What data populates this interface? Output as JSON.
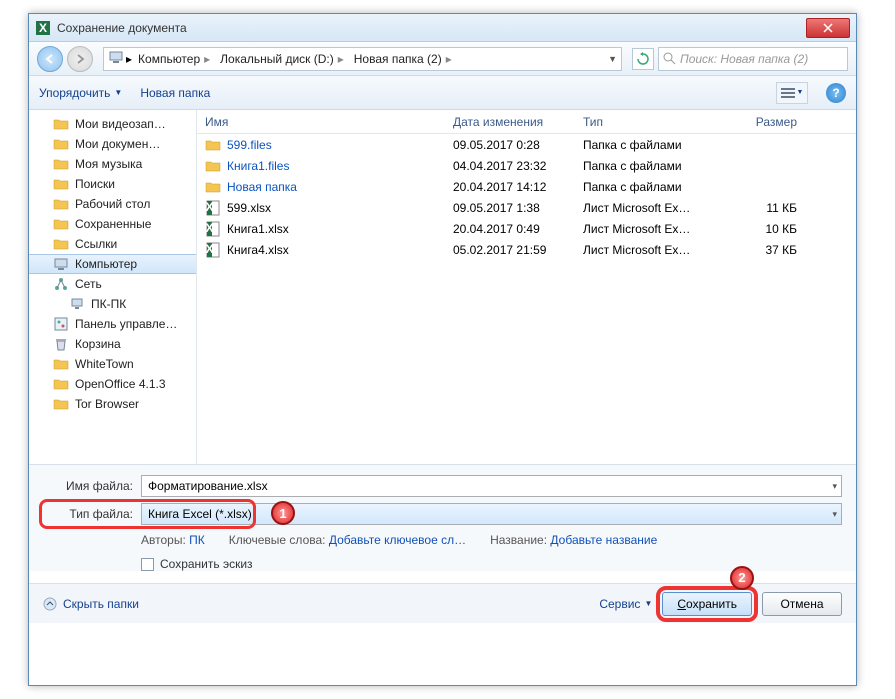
{
  "title": "Сохранение документа",
  "breadcrumbs": [
    "Компьютер",
    "Локальный диск (D:)",
    "Новая папка (2)"
  ],
  "search_placeholder": "Поиск: Новая папка (2)",
  "toolbar": {
    "organize": "Упорядочить",
    "newfolder": "Новая папка"
  },
  "tree": [
    {
      "label": "Мои видеозап…",
      "icon": "folder"
    },
    {
      "label": "Мои докумен…",
      "icon": "folder"
    },
    {
      "label": "Моя музыка",
      "icon": "folder"
    },
    {
      "label": "Поиски",
      "icon": "folder"
    },
    {
      "label": "Рабочий стол",
      "icon": "folder"
    },
    {
      "label": "Сохраненные",
      "icon": "folder"
    },
    {
      "label": "Ссылки",
      "icon": "folder"
    },
    {
      "label": "Компьютер",
      "icon": "computer",
      "selected": true
    },
    {
      "label": "Сеть",
      "icon": "network"
    },
    {
      "label": "ПК-ПК",
      "icon": "pc",
      "indent": true
    },
    {
      "label": "Панель управле…",
      "icon": "control"
    },
    {
      "label": "Корзина",
      "icon": "bin"
    },
    {
      "label": "WhiteTown",
      "icon": "folder"
    },
    {
      "label": "OpenOffice 4.1.3",
      "icon": "folder"
    },
    {
      "label": "Tor Browser",
      "icon": "folder"
    }
  ],
  "columns": {
    "name": "Имя",
    "date": "Дата изменения",
    "type": "Тип",
    "size": "Размер"
  },
  "rows": [
    {
      "name": "599.files",
      "date": "09.05.2017 0:28",
      "type": "Папка с файлами",
      "size": "",
      "icon": "folder",
      "link": true
    },
    {
      "name": "Книга1.files",
      "date": "04.04.2017 23:32",
      "type": "Папка с файлами",
      "size": "",
      "icon": "folder",
      "link": true
    },
    {
      "name": "Новая папка",
      "date": "20.04.2017 14:12",
      "type": "Папка с файлами",
      "size": "",
      "icon": "folder",
      "link": true
    },
    {
      "name": "599.xlsx",
      "date": "09.05.2017 1:38",
      "type": "Лист Microsoft Ex…",
      "size": "11 КБ",
      "icon": "xlsx"
    },
    {
      "name": "Книга1.xlsx",
      "date": "20.04.2017 0:49",
      "type": "Лист Microsoft Ex…",
      "size": "10 КБ",
      "icon": "xlsx"
    },
    {
      "name": "Книга4.xlsx",
      "date": "05.02.2017 21:59",
      "type": "Лист Microsoft Ex…",
      "size": "37 КБ",
      "icon": "xlsx"
    }
  ],
  "filename_label": "Имя файла:",
  "filename_value": "Форматирование.xlsx",
  "filetype_label": "Тип файла:",
  "filetype_value": "Книга Excel (*.xlsx)",
  "meta": {
    "authors_label": "Авторы:",
    "authors_value": "ПК",
    "keywords_label": "Ключевые слова:",
    "keywords_value": "Добавьте ключевое сл…",
    "title_label": "Название:",
    "title_value": "Добавьте название"
  },
  "save_thumb": "Сохранить эскиз",
  "hide_folders": "Скрыть папки",
  "service": "Сервис",
  "save": "Сохранить",
  "cancel": "Отмена",
  "annotations": {
    "badge1": "1",
    "badge2": "2"
  }
}
